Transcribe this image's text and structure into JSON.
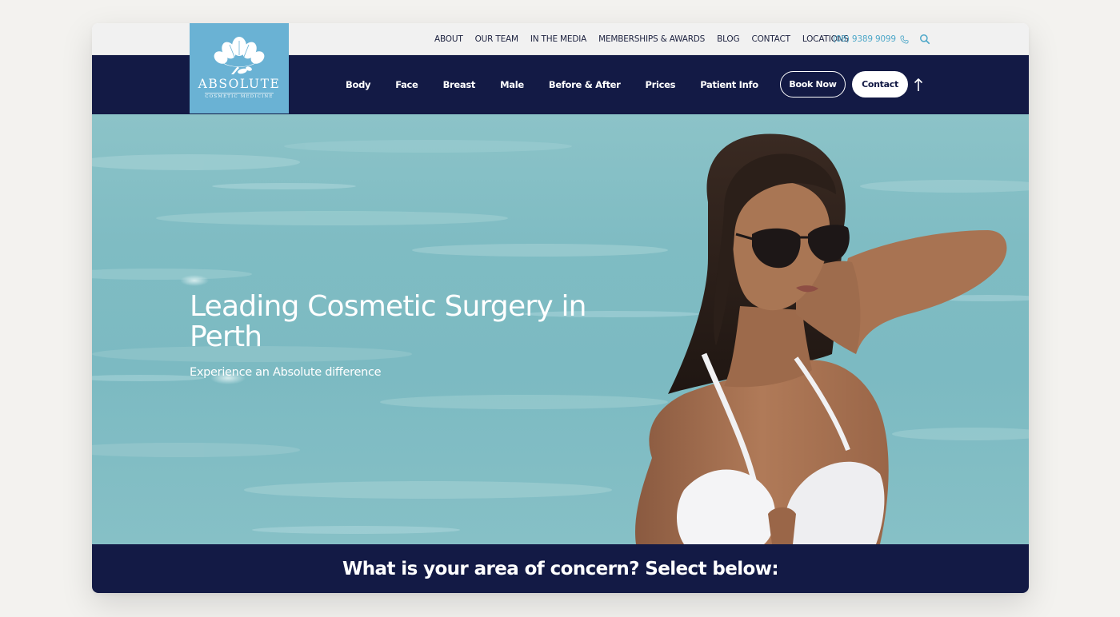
{
  "brand": {
    "name": "ABSOLUTE",
    "tagline": "COSMETIC MEDICINE",
    "logo_color": "#6ab2d4"
  },
  "top_nav": {
    "links": [
      "ABOUT",
      "OUR TEAM",
      "IN THE MEDIA",
      "MEMBERSHIPS & AWARDS",
      "BLOG",
      "CONTACT",
      "LOCATIONS"
    ],
    "phone": "(08) 9389 9099",
    "phone_icon": "phone-icon",
    "search_icon": "search-icon"
  },
  "main_nav": {
    "links": [
      "Body",
      "Face",
      "Breast",
      "Male",
      "Before & After",
      "Prices",
      "Patient Info"
    ],
    "book_label": "Book Now",
    "contact_label": "Contact",
    "arrow_icon": "arrow-up-icon",
    "background": "#131a45"
  },
  "hero": {
    "title": "Leading Cosmetic Surgery in Perth",
    "subtitle": "Experience an Absolute difference"
  },
  "concern": {
    "heading": "What is your area of concern? Select below:"
  },
  "colors": {
    "navy": "#131a45",
    "accent_blue": "#4fa8c9",
    "water": "#7cbac2"
  }
}
